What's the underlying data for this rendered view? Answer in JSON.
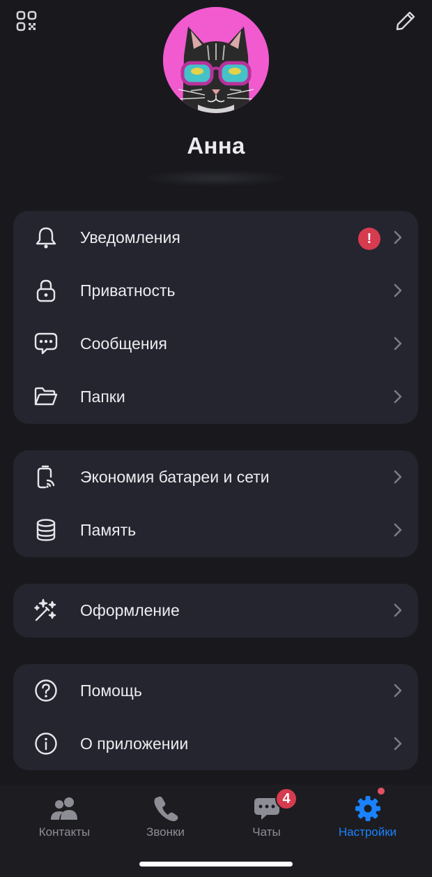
{
  "profile": {
    "name": "Анна"
  },
  "groups": [
    {
      "items": [
        {
          "label": "Уведомления",
          "icon": "bell-icon",
          "alert": "!"
        },
        {
          "label": "Приватность",
          "icon": "lock-icon"
        },
        {
          "label": "Сообщения",
          "icon": "chat-bubble-icon"
        },
        {
          "label": "Папки",
          "icon": "folder-icon"
        }
      ]
    },
    {
      "items": [
        {
          "label": "Экономия батареи и сети",
          "icon": "battery-network-icon"
        },
        {
          "label": "Память",
          "icon": "database-icon"
        }
      ]
    },
    {
      "items": [
        {
          "label": "Оформление",
          "icon": "magic-wand-icon"
        }
      ]
    },
    {
      "items": [
        {
          "label": "Помощь",
          "icon": "help-circle-icon"
        },
        {
          "label": "О приложении",
          "icon": "info-circle-icon"
        }
      ]
    }
  ],
  "tabbar": {
    "tabs": [
      {
        "label": "Контакты",
        "icon": "contacts-icon"
      },
      {
        "label": "Звонки",
        "icon": "phone-icon"
      },
      {
        "label": "Чаты",
        "icon": "chats-icon",
        "badge": "4"
      },
      {
        "label": "Настройки",
        "icon": "settings-gear-icon",
        "active": true
      }
    ]
  },
  "colors": {
    "background": "#19191d",
    "card": "#25252f",
    "accent": "#1a82ff",
    "badge": "#d63b4f",
    "avatar_bg": "#f25ad0"
  }
}
